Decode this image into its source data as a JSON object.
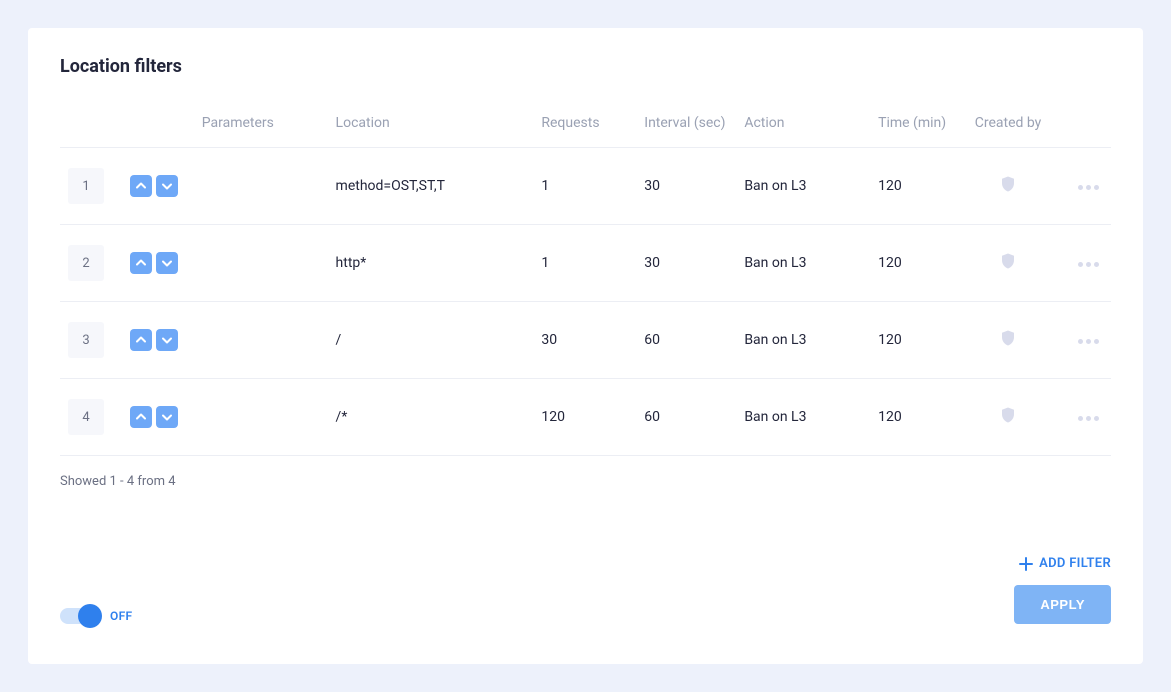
{
  "title": "Location filters",
  "headers": {
    "parameters": "Parameters",
    "location": "Location",
    "requests": "Requests",
    "interval": "Interval (sec)",
    "action": "Action",
    "time": "Time (min)",
    "created_by": "Created by"
  },
  "rows": [
    {
      "index": "1",
      "parameters": "",
      "location": "method=OST,ST,T",
      "requests": "1",
      "interval": "30",
      "action": "Ban on L3",
      "time": "120"
    },
    {
      "index": "2",
      "parameters": "",
      "location": "http*",
      "requests": "1",
      "interval": "30",
      "action": "Ban on L3",
      "time": "120"
    },
    {
      "index": "3",
      "parameters": "",
      "location": "/",
      "requests": "30",
      "interval": "60",
      "action": "Ban on L3",
      "time": "120"
    },
    {
      "index": "4",
      "parameters": "",
      "location": "/*",
      "requests": "120",
      "interval": "60",
      "action": "Ban on L3",
      "time": "120"
    }
  ],
  "footer": "Showed 1 - 4 from 4",
  "toggle": {
    "label": "OFF"
  },
  "buttons": {
    "add_filter": "ADD FILTER",
    "apply": "APPLY"
  }
}
